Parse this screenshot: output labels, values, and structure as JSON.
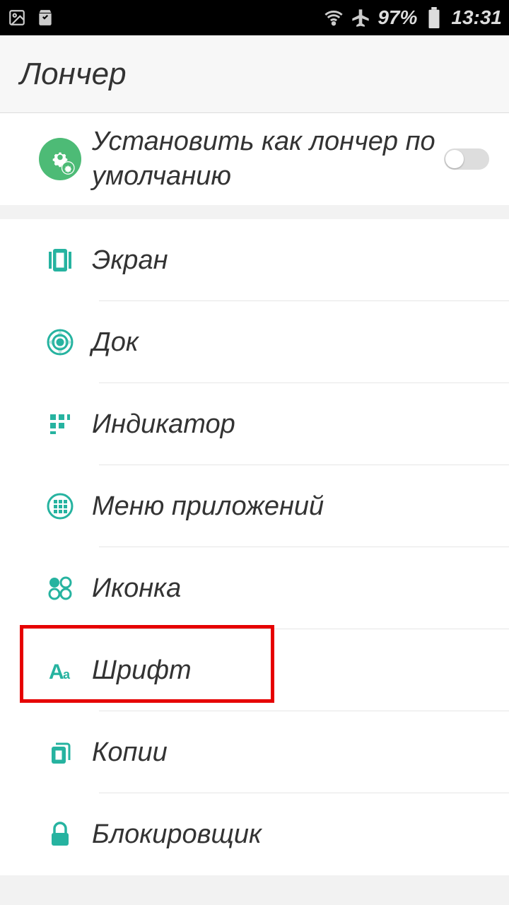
{
  "statusbar": {
    "battery_percent": "97%",
    "time": "13:31"
  },
  "header": {
    "title": "Лончер"
  },
  "default_section": {
    "label": "Установить как лончер по умолчанию",
    "toggle": false
  },
  "settings": [
    {
      "id": "screen",
      "label": "Экран",
      "icon": "screen-icon"
    },
    {
      "id": "dock",
      "label": "Док",
      "icon": "dock-icon"
    },
    {
      "id": "indicator",
      "label": "Индикатор",
      "icon": "indicator-icon"
    },
    {
      "id": "appmenu",
      "label": "Меню приложений",
      "icon": "appmenu-icon"
    },
    {
      "id": "icon",
      "label": "Иконка",
      "icon": "iconset-icon"
    },
    {
      "id": "font",
      "label": "Шрифт",
      "icon": "font-icon",
      "highlighted": true
    },
    {
      "id": "copies",
      "label": "Копии",
      "icon": "copies-icon"
    },
    {
      "id": "blocker",
      "label": "Блокировщик",
      "icon": "lock-icon"
    }
  ],
  "colors": {
    "accent": "#26b3a0"
  }
}
